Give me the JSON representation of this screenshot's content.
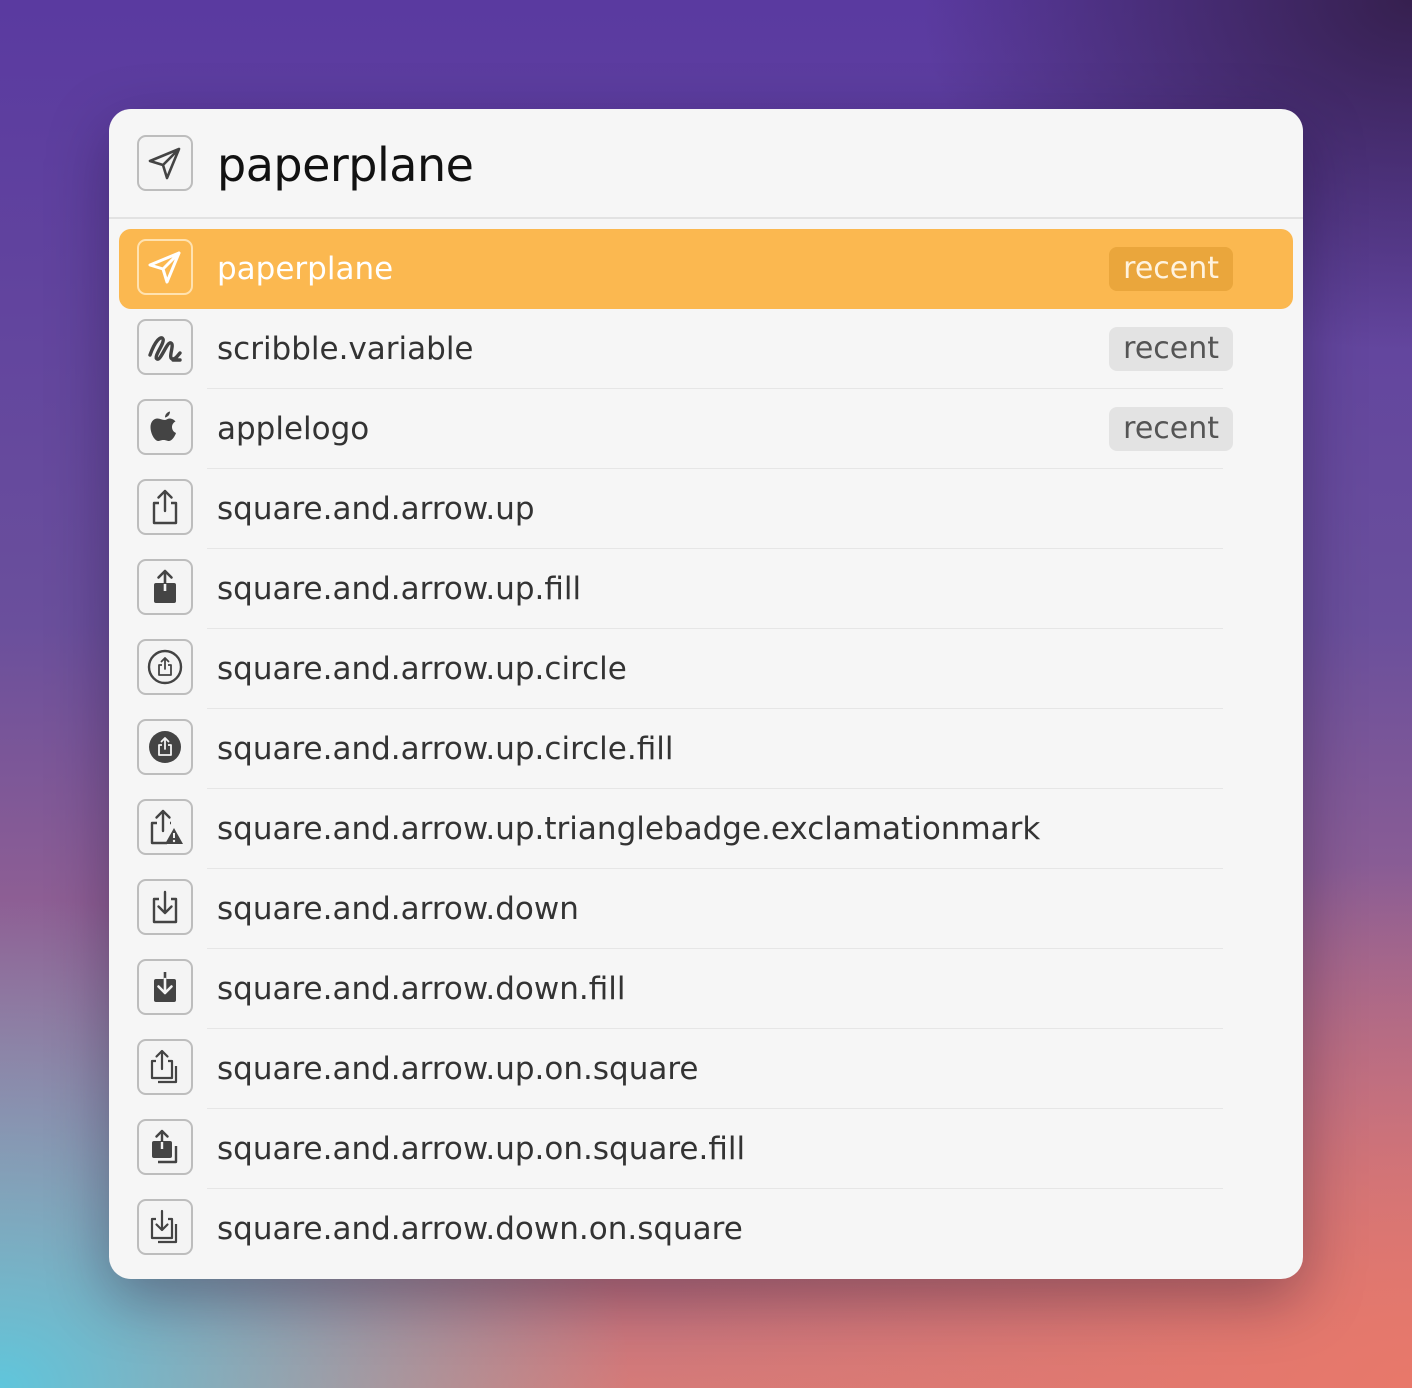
{
  "search": {
    "value": "paperplane",
    "icon": "paperplane-icon"
  },
  "colors": {
    "accent": "#fbb850",
    "badge_bg": "#e3e3e3"
  },
  "results": [
    {
      "label": "paperplane",
      "badge": "recent",
      "icon": "paperplane-icon",
      "selected": true
    },
    {
      "label": "scribble.variable",
      "badge": "recent",
      "icon": "scribble-icon"
    },
    {
      "label": "applelogo",
      "badge": "recent",
      "icon": "apple-logo-icon"
    },
    {
      "label": "square.and.arrow.up",
      "icon": "share-icon"
    },
    {
      "label": "square.and.arrow.up.fill",
      "icon": "share-fill-icon"
    },
    {
      "label": "square.and.arrow.up.circle",
      "icon": "share-circle-icon"
    },
    {
      "label": "square.and.arrow.up.circle.fill",
      "icon": "share-circle-fill-icon"
    },
    {
      "label": "square.and.arrow.up.trianglebadge.exclamationmark",
      "icon": "share-warning-icon"
    },
    {
      "label": "square.and.arrow.down",
      "icon": "download-icon"
    },
    {
      "label": "square.and.arrow.down.fill",
      "icon": "download-fill-icon"
    },
    {
      "label": "square.and.arrow.up.on.square",
      "icon": "share-on-square-icon"
    },
    {
      "label": "square.and.arrow.up.on.square.fill",
      "icon": "share-on-square-fill-icon"
    },
    {
      "label": "square.and.arrow.down.on.square",
      "icon": "download-on-square-icon"
    }
  ]
}
